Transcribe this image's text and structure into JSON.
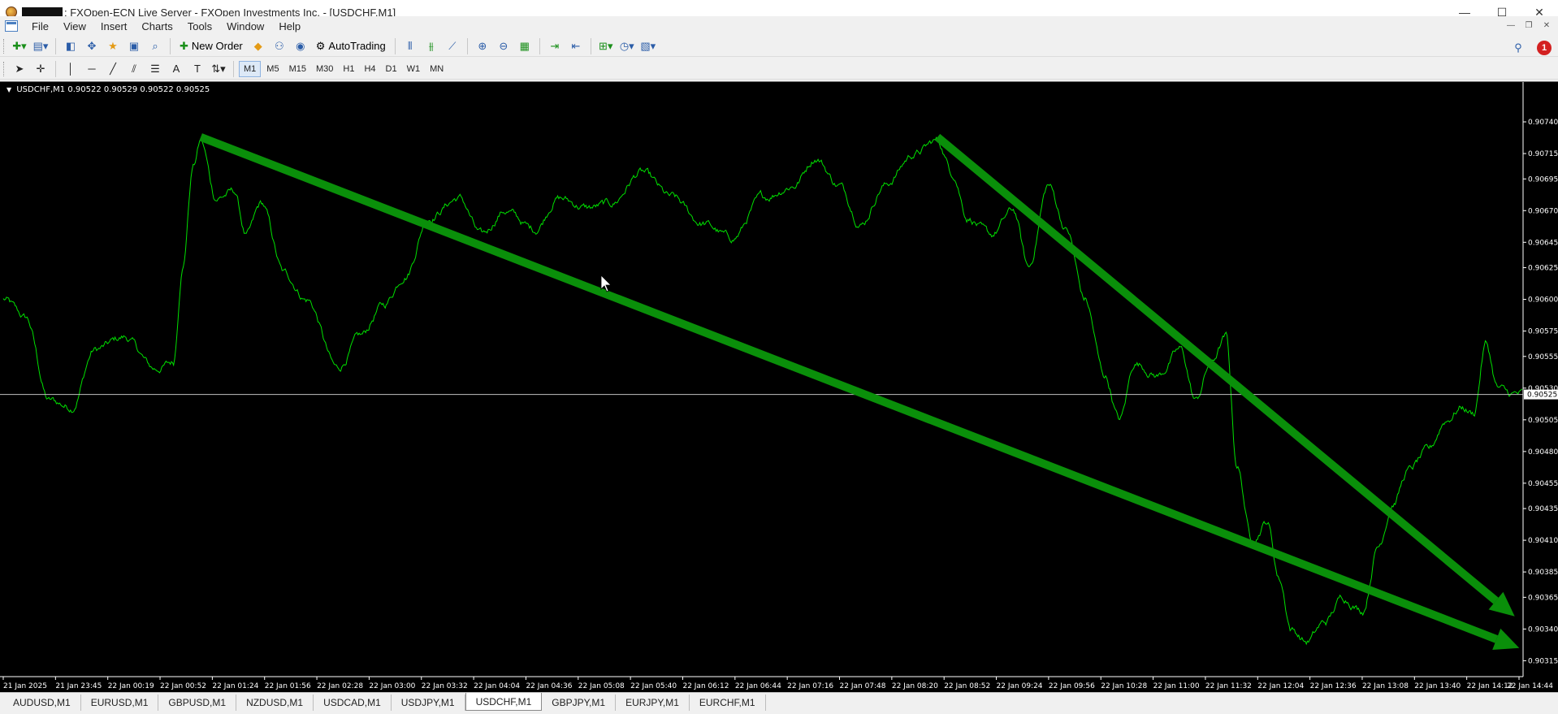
{
  "window": {
    "title": ": FXOpen-ECN Live Server - FXOpen Investments Inc. - [USDCHF,M1]",
    "controls": [
      "—",
      "☐",
      "✕"
    ]
  },
  "menu": [
    "File",
    "View",
    "Insert",
    "Charts",
    "Tools",
    "Window",
    "Help"
  ],
  "mdi_controls": [
    "—",
    "❐",
    "✕"
  ],
  "toolbar1": {
    "new_order": "New Order",
    "autotrading": "AutoTrading",
    "notification_count": "1"
  },
  "timeframes": [
    {
      "label": "M1",
      "active": true
    },
    {
      "label": "M5",
      "active": false
    },
    {
      "label": "M15",
      "active": false
    },
    {
      "label": "M30",
      "active": false
    },
    {
      "label": "H1",
      "active": false
    },
    {
      "label": "H4",
      "active": false
    },
    {
      "label": "D1",
      "active": false
    },
    {
      "label": "W1",
      "active": false
    },
    {
      "label": "MN",
      "active": false
    }
  ],
  "chart_info": {
    "symbol": "USDCHF,M1",
    "ohlc": "0.90522 0.90529 0.90522 0.90525"
  },
  "chart_data": {
    "type": "line",
    "series_color": "#00e000",
    "background": "#000000",
    "current_price": 0.90525,
    "current_price_label": "0.90525",
    "ylim": [
      0.90305,
      0.90765
    ],
    "y_ticks": [
      "0.90740",
      "0.90715",
      "0.90695",
      "0.90670",
      "0.90645",
      "0.90625",
      "0.90600",
      "0.90575",
      "0.90555",
      "0.90530",
      "0.90505",
      "0.90480",
      "0.90455",
      "0.90435",
      "0.90410",
      "0.90385",
      "0.90365",
      "0.90340",
      "0.90315"
    ],
    "x_ticks": [
      "21 Jan 2025",
      "21 Jan 23:45",
      "22 Jan 00:19",
      "22 Jan 00:52",
      "22 Jan 01:24",
      "22 Jan 01:56",
      "22 Jan 02:28",
      "22 Jan 03:00",
      "22 Jan 03:32",
      "22 Jan 04:04",
      "22 Jan 04:36",
      "22 Jan 05:08",
      "22 Jan 05:40",
      "22 Jan 06:12",
      "22 Jan 06:44",
      "22 Jan 07:16",
      "22 Jan 07:48",
      "22 Jan 08:20",
      "22 Jan 08:52",
      "22 Jan 09:24",
      "22 Jan 09:56",
      "22 Jan 10:28",
      "22 Jan 11:00",
      "22 Jan 11:32",
      "22 Jan 12:04",
      "22 Jan 12:36",
      "22 Jan 13:08",
      "22 Jan 13:40",
      "22 Jan 14:12",
      "22 Jan 14:44"
    ],
    "price_anchors": [
      {
        "t": 0.0,
        "p": 0.906
      },
      {
        "t": 0.015,
        "p": 0.90585
      },
      {
        "t": 0.03,
        "p": 0.9052
      },
      {
        "t": 0.045,
        "p": 0.90515
      },
      {
        "t": 0.06,
        "p": 0.9056
      },
      {
        "t": 0.08,
        "p": 0.9057
      },
      {
        "t": 0.1,
        "p": 0.90545
      },
      {
        "t": 0.112,
        "p": 0.9055
      },
      {
        "t": 0.118,
        "p": 0.90625
      },
      {
        "t": 0.125,
        "p": 0.90705
      },
      {
        "t": 0.13,
        "p": 0.90725
      },
      {
        "t": 0.14,
        "p": 0.9068
      },
      {
        "t": 0.152,
        "p": 0.90685
      },
      {
        "t": 0.16,
        "p": 0.9065
      },
      {
        "t": 0.17,
        "p": 0.90675
      },
      {
        "t": 0.185,
        "p": 0.9062
      },
      {
        "t": 0.2,
        "p": 0.906
      },
      {
        "t": 0.22,
        "p": 0.90545
      },
      {
        "t": 0.235,
        "p": 0.9057
      },
      {
        "t": 0.25,
        "p": 0.90595
      },
      {
        "t": 0.265,
        "p": 0.9062
      },
      {
        "t": 0.28,
        "p": 0.90665
      },
      {
        "t": 0.3,
        "p": 0.9068
      },
      {
        "t": 0.315,
        "p": 0.9065
      },
      {
        "t": 0.33,
        "p": 0.9067
      },
      {
        "t": 0.35,
        "p": 0.90655
      },
      {
        "t": 0.365,
        "p": 0.9068
      },
      {
        "t": 0.385,
        "p": 0.90672
      },
      {
        "t": 0.4,
        "p": 0.90675
      },
      {
        "t": 0.42,
        "p": 0.907
      },
      {
        "t": 0.44,
        "p": 0.9068
      },
      {
        "t": 0.46,
        "p": 0.9066
      },
      {
        "t": 0.48,
        "p": 0.90648
      },
      {
        "t": 0.5,
        "p": 0.9068
      },
      {
        "t": 0.52,
        "p": 0.9069
      },
      {
        "t": 0.535,
        "p": 0.90712
      },
      {
        "t": 0.55,
        "p": 0.9069
      },
      {
        "t": 0.565,
        "p": 0.9066
      },
      {
        "t": 0.58,
        "p": 0.9069
      },
      {
        "t": 0.6,
        "p": 0.90715
      },
      {
        "t": 0.615,
        "p": 0.90725
      },
      {
        "t": 0.625,
        "p": 0.907
      },
      {
        "t": 0.635,
        "p": 0.90665
      },
      {
        "t": 0.65,
        "p": 0.9065
      },
      {
        "t": 0.665,
        "p": 0.9067
      },
      {
        "t": 0.675,
        "p": 0.90625
      },
      {
        "t": 0.688,
        "p": 0.9069
      },
      {
        "t": 0.7,
        "p": 0.90655
      },
      {
        "t": 0.712,
        "p": 0.906
      },
      {
        "t": 0.725,
        "p": 0.9054
      },
      {
        "t": 0.735,
        "p": 0.90505
      },
      {
        "t": 0.745,
        "p": 0.9055
      },
      {
        "t": 0.76,
        "p": 0.9054
      },
      {
        "t": 0.775,
        "p": 0.9056
      },
      {
        "t": 0.785,
        "p": 0.9052
      },
      {
        "t": 0.795,
        "p": 0.9055
      },
      {
        "t": 0.805,
        "p": 0.9057
      },
      {
        "t": 0.812,
        "p": 0.9047
      },
      {
        "t": 0.822,
        "p": 0.9041
      },
      {
        "t": 0.832,
        "p": 0.90425
      },
      {
        "t": 0.84,
        "p": 0.9038
      },
      {
        "t": 0.848,
        "p": 0.9034
      },
      {
        "t": 0.858,
        "p": 0.9033
      },
      {
        "t": 0.87,
        "p": 0.90345
      },
      {
        "t": 0.882,
        "p": 0.90365
      },
      {
        "t": 0.895,
        "p": 0.90355
      },
      {
        "t": 0.905,
        "p": 0.90405
      },
      {
        "t": 0.915,
        "p": 0.9044
      },
      {
        "t": 0.925,
        "p": 0.90465
      },
      {
        "t": 0.938,
        "p": 0.9048
      },
      {
        "t": 0.95,
        "p": 0.90505
      },
      {
        "t": 0.96,
        "p": 0.90515
      },
      {
        "t": 0.968,
        "p": 0.9051
      },
      {
        "t": 0.976,
        "p": 0.90565
      },
      {
        "t": 0.984,
        "p": 0.9053
      },
      {
        "t": 0.992,
        "p": 0.90525
      },
      {
        "t": 1.0,
        "p": 0.90525
      }
    ],
    "trend_arrows": [
      {
        "t1": 0.13,
        "p1": 0.90728,
        "t2": 0.998,
        "p2": 0.90325,
        "color": "#0a8f0a"
      },
      {
        "t1": 0.615,
        "p1": 0.90728,
        "t2": 0.995,
        "p2": 0.9035,
        "color": "#0a8f0a"
      }
    ],
    "grid": false,
    "legend": "none"
  },
  "tabs": [
    {
      "label": "AUDUSD,M1",
      "active": false
    },
    {
      "label": "EURUSD,M1",
      "active": false
    },
    {
      "label": "GBPUSD,M1",
      "active": false
    },
    {
      "label": "NZDUSD,M1",
      "active": false
    },
    {
      "label": "USDCAD,M1",
      "active": false
    },
    {
      "label": "USDJPY,M1",
      "active": false
    },
    {
      "label": "USDCHF,M1",
      "active": true
    },
    {
      "label": "GBPJPY,M1",
      "active": false
    },
    {
      "label": "EURJPY,M1",
      "active": false
    },
    {
      "label": "EURCHF,M1",
      "active": false
    }
  ]
}
